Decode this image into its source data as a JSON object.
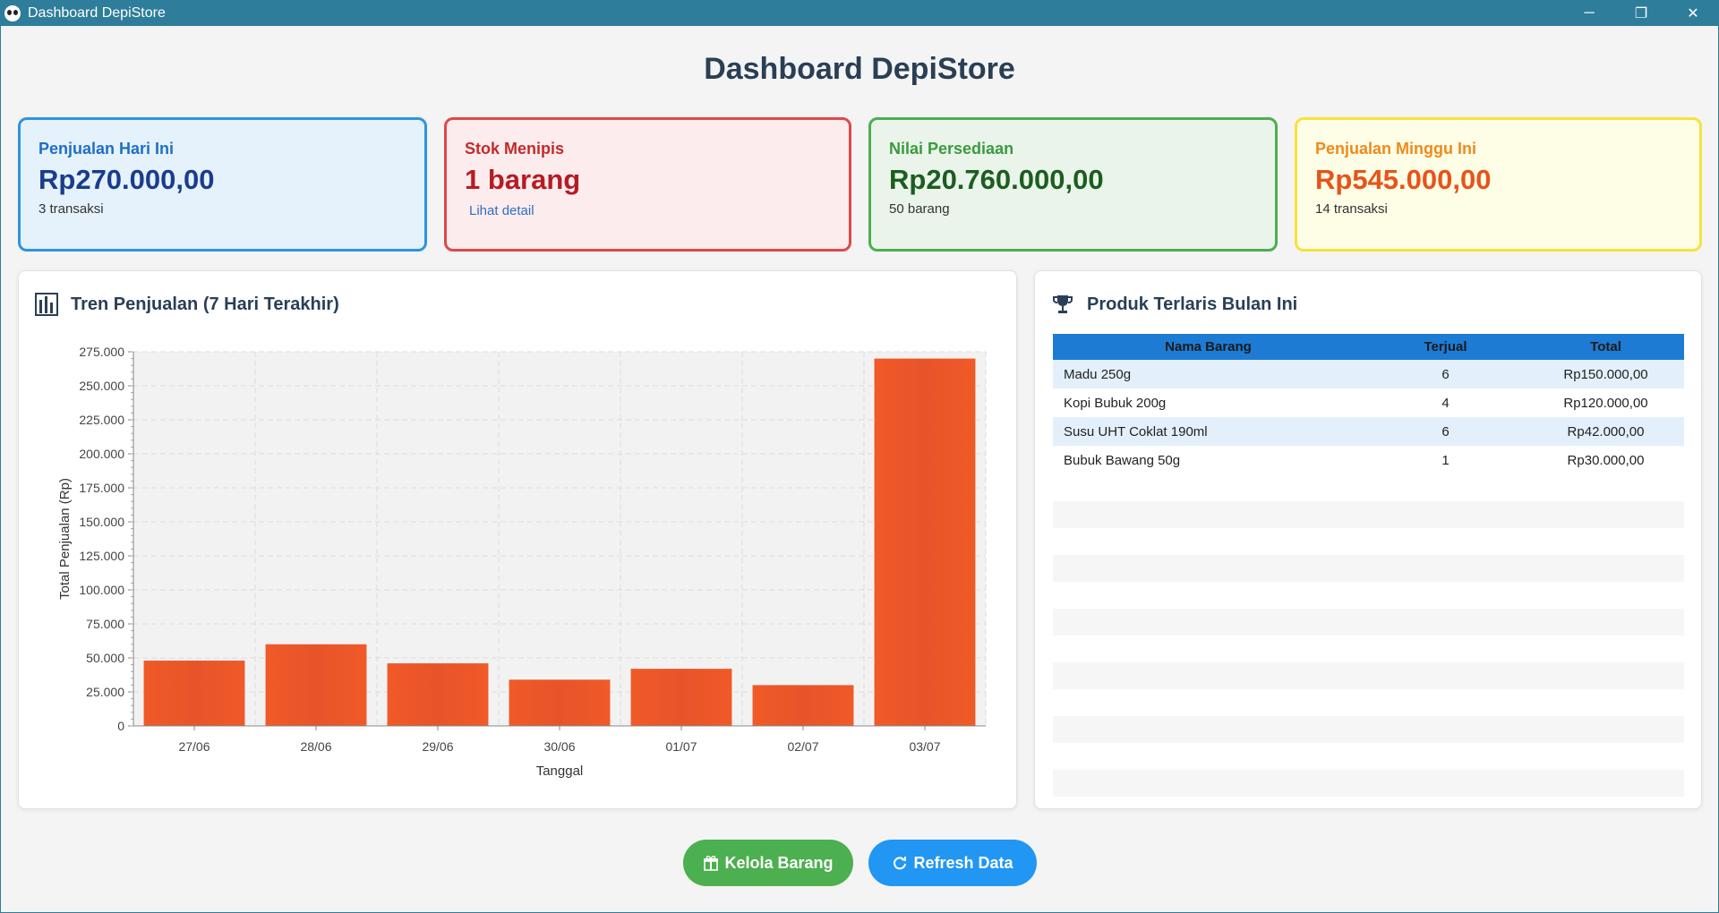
{
  "window": {
    "title": "Dashboard DepiStore",
    "controls": {
      "minimize": "─",
      "restore": "❐",
      "close": "✕"
    }
  },
  "page_title": "Dashboard DepiStore",
  "cards": {
    "sales_today": {
      "label": "Penjualan Hari Ini",
      "value": "Rp270.000,00",
      "sub": "3 transaksi"
    },
    "low_stock": {
      "label": "Stok Menipis",
      "value": "1 barang",
      "link": "Lihat detail"
    },
    "inventory_value": {
      "label": "Nilai Persediaan",
      "value": "Rp20.760.000,00",
      "sub": "50 barang"
    },
    "sales_week": {
      "label": "Penjualan Minggu Ini",
      "value": "Rp545.000,00",
      "sub": "14 transaksi"
    }
  },
  "chart_panel": {
    "title": "Tren Penjualan (7 Hari Terakhir)",
    "icon": "bar-chart-icon"
  },
  "table_panel": {
    "title": "Produk Terlaris Bulan Ini",
    "icon": "trophy-icon",
    "headers": [
      "Nama Barang",
      "Terjual",
      "Total"
    ],
    "rows": [
      [
        "Madu 250g",
        "6",
        "Rp150.000,00"
      ],
      [
        "Kopi Bubuk 200g",
        "4",
        "Rp120.000,00"
      ],
      [
        "Susu UHT Coklat 190ml",
        "6",
        "Rp42.000,00"
      ],
      [
        "Bubuk Bawang 50g",
        "1",
        "Rp30.000,00"
      ]
    ]
  },
  "buttons": {
    "kelola": {
      "label": "Kelola Barang",
      "icon": "gift-icon"
    },
    "refresh": {
      "label": "Refresh Data",
      "icon": "refresh-icon"
    }
  },
  "colors": {
    "bar": "#f05a28",
    "table_header": "#1e7bd4",
    "titlebar": "#2e7d9a"
  },
  "chart_data": {
    "type": "bar",
    "categories": [
      "27/06",
      "28/06",
      "29/06",
      "30/06",
      "01/07",
      "02/07",
      "03/07"
    ],
    "values": [
      48000,
      60000,
      46000,
      34000,
      42000,
      30000,
      270000
    ],
    "title": "",
    "xlabel": "Tanggal",
    "ylabel": "Total Penjualan (Rp)",
    "ylim": [
      0,
      275000
    ],
    "yticks": [
      "0",
      "25.000",
      "50.000",
      "75.000",
      "100.000",
      "125.000",
      "150.000",
      "175.000",
      "200.000",
      "225.000",
      "250.000",
      "275.000"
    ],
    "grid": true
  }
}
